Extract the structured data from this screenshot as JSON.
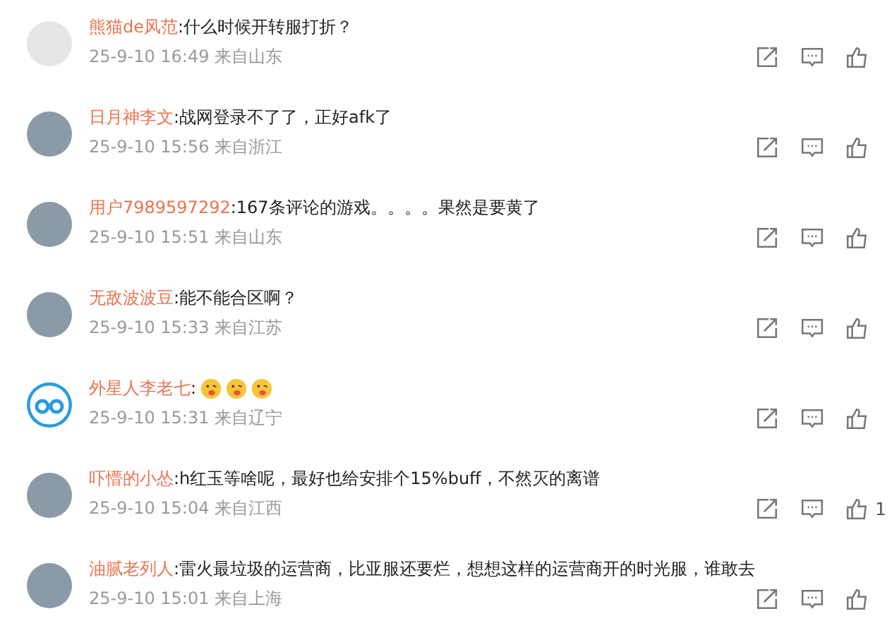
{
  "comments": [
    {
      "kind": "blank",
      "name": "熊猫de风范",
      "text": ":什么时候开转服打折？",
      "time": "25-9-10 16:49 来自山东"
    },
    {
      "kind": "photo",
      "name": "日月神李文",
      "text": ":战网登录不了了，正好afk了",
      "time": "25-9-10 15:56 来自浙江"
    },
    {
      "kind": "photo",
      "name": "用户7989597292",
      "text": ":167条评论的游戏。。。。果然是要黄了",
      "time": "25-9-10 15:51 来自山东"
    },
    {
      "kind": "photo",
      "name": "无敌波波豆",
      "text": ":能不能合区啊？",
      "time": "25-9-10 15:33 来自江苏"
    },
    {
      "kind": "logo",
      "name": "外星人李老七",
      "text": ":",
      "emojis": [
        {
          "kind": "tongue-face"
        },
        {
          "kind": "tongue-face"
        },
        {
          "kind": "tongue-face"
        }
      ],
      "time": "25-9-10 15:31 来自辽宁"
    },
    {
      "kind": "photo",
      "name": "吓懵的小怂",
      "text": ":h红玉等啥呢，最好也给安排个15%buff，不然灭的离谱",
      "time": "25-9-10 15:04 来自江西",
      "likes": "1"
    },
    {
      "kind": "photo",
      "name": "油腻老列人",
      "text": ":雷火最垃圾的运营商，比亚服还要烂，想想这样的运营商开的时光服，谁敢去",
      "time": "25-9-10 15:01 来自上海"
    }
  ]
}
